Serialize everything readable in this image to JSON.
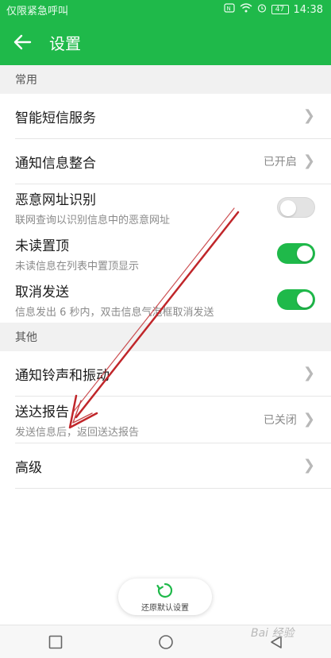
{
  "status_bar": {
    "left_text": "仅限紧急呼叫",
    "battery": "47",
    "time": "14:38"
  },
  "app_bar": {
    "title": "设置",
    "back_icon": "arrow-left-icon"
  },
  "sections": {
    "common": {
      "header": "常用",
      "items": [
        {
          "label": "智能短信服务",
          "control": "chevron"
        },
        {
          "label": "通知信息整合",
          "value": "已开启",
          "control": "chevron"
        },
        {
          "label": "恶意网址识别",
          "sub": "联网查询以识别信息中的恶意网址",
          "control": "toggle",
          "on": false
        },
        {
          "label": "未读置顶",
          "sub": "未读信息在列表中置顶显示",
          "control": "toggle",
          "on": true
        },
        {
          "label": "取消发送",
          "sub": "信息发出 6 秒内，双击信息气泡框取消发送",
          "control": "toggle",
          "on": true
        }
      ]
    },
    "other": {
      "header": "其他",
      "items": [
        {
          "label": "通知铃声和振动",
          "control": "chevron"
        },
        {
          "label": "送达报告",
          "sub": "发送信息后，返回送达报告",
          "value": "已关闭",
          "control": "chevron"
        },
        {
          "label": "高级",
          "control": "chevron"
        }
      ]
    }
  },
  "restore_button": {
    "label": "还原默认设置",
    "icon": "refresh-icon"
  },
  "nav_bar": {
    "icons": [
      "square-icon",
      "circle-icon",
      "back-triangle-icon"
    ]
  },
  "watermark": "Bai 经验",
  "colors": {
    "primary": "#1fb94a",
    "annotation_arrow": "#c0262a"
  }
}
